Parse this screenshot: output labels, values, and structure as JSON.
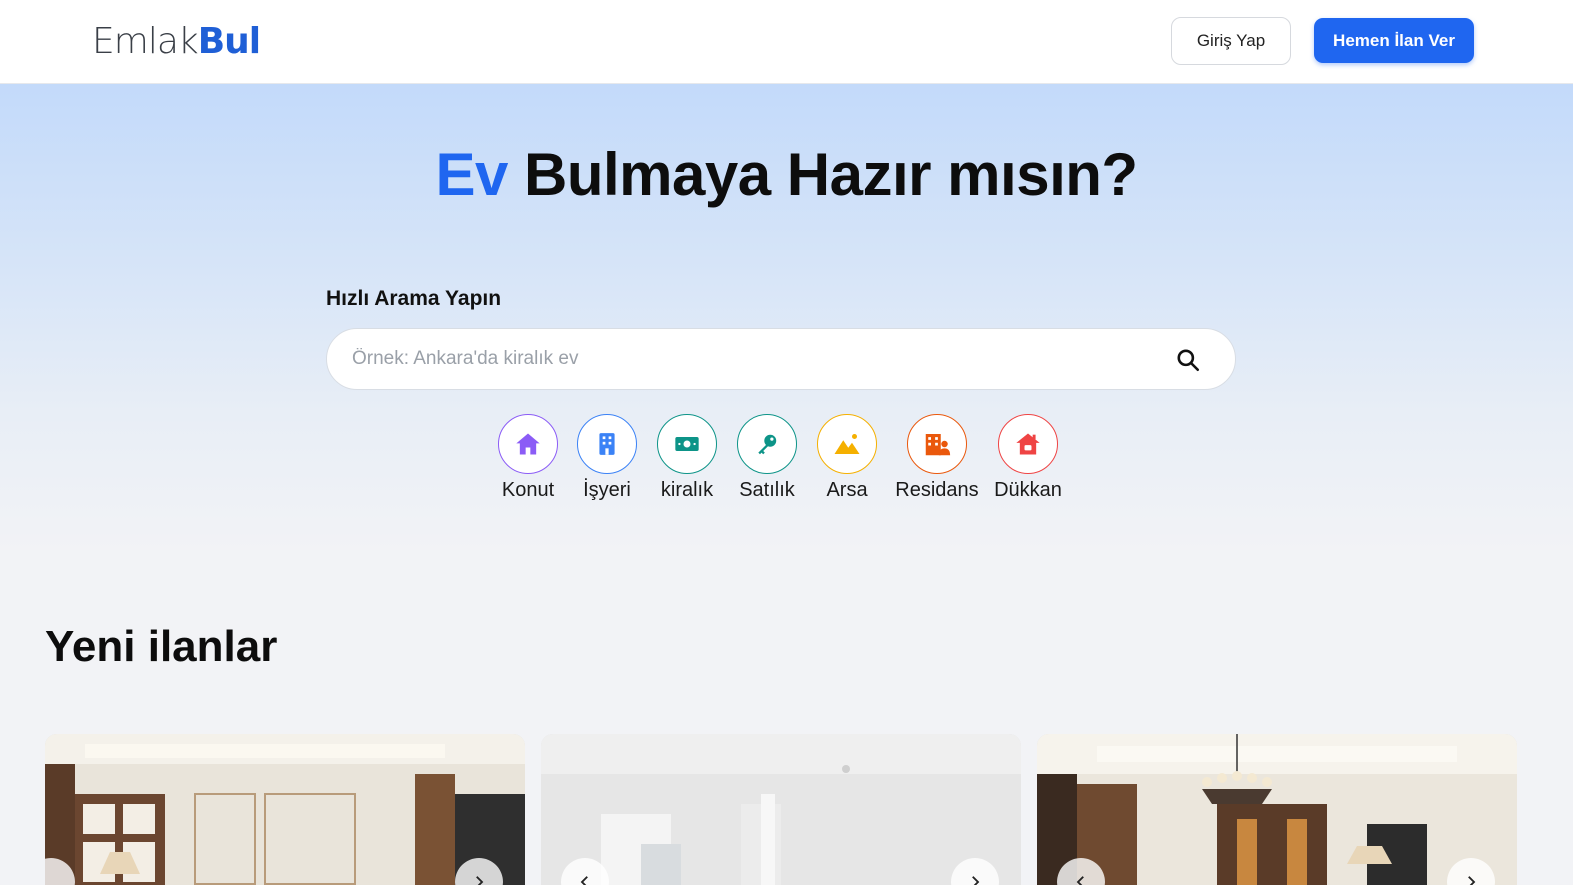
{
  "header": {
    "logo_part1": "Emlak",
    "logo_part2": "Bul",
    "login_label": "Giriş Yap",
    "post_label": "Hemen İlan Ver"
  },
  "hero": {
    "title_accent": "Ev",
    "title_rest": " Bulmaya Hazır mısın?",
    "search_label": "Hızlı Arama Yapın",
    "search_placeholder": "Örnek: Ankara'da kiralık ev",
    "categories": [
      {
        "label": "Konut",
        "icon": "house-icon",
        "color": "#8b5cf6"
      },
      {
        "label": "İşyeri",
        "icon": "building-icon",
        "color": "#3b82f6"
      },
      {
        "label": "kiralık",
        "icon": "money-icon",
        "color": "#0d9488"
      },
      {
        "label": "Satılık",
        "icon": "key-icon",
        "color": "#0d9488"
      },
      {
        "label": "Arsa",
        "icon": "landscape-icon",
        "color": "#f5b000"
      },
      {
        "label": "Residans",
        "icon": "residence-icon",
        "color": "#ea580c"
      },
      {
        "label": "Dükkan",
        "icon": "shop-icon",
        "color": "#ef4444"
      }
    ]
  },
  "listings": {
    "title": "Yeni ilanlar"
  },
  "colors": {
    "brand_blue": "#1f66f0",
    "logo_dark": "#3a3f47"
  }
}
